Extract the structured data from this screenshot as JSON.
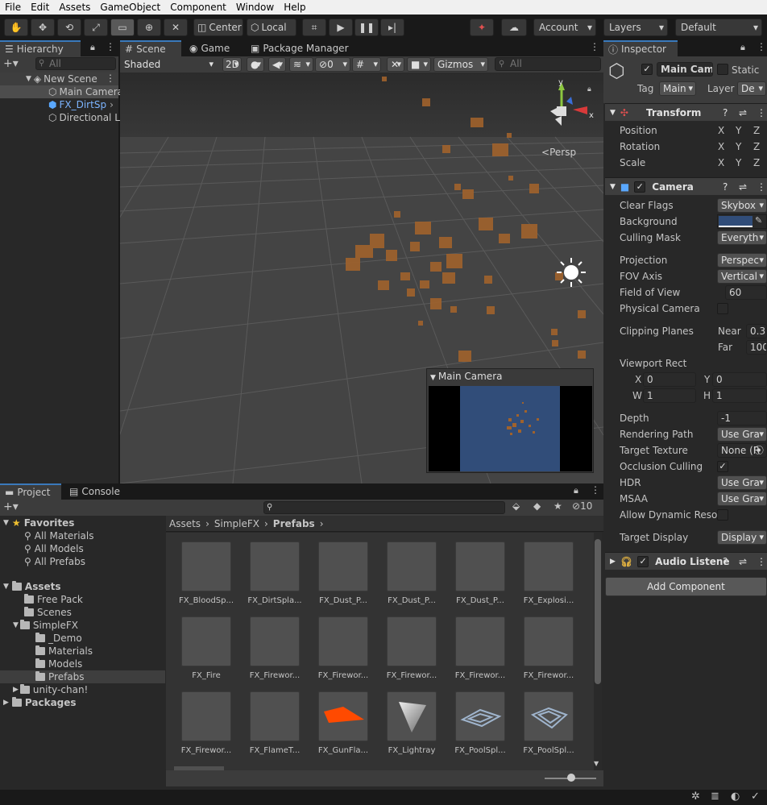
{
  "menu": [
    "File",
    "Edit",
    "Assets",
    "GameObject",
    "Component",
    "Window",
    "Help"
  ],
  "toolbar": {
    "pivot": "Center",
    "space": "Local",
    "account": "Account",
    "layers": "Layers",
    "layout": "Default"
  },
  "hierarchy": {
    "tab": "Hierarchy",
    "search_placeholder": "All",
    "scene": "New Scene",
    "items": [
      "Main Camera",
      "FX_DirtSp",
      "Directional L"
    ]
  },
  "scene": {
    "tabs": [
      "Scene",
      "Game",
      "Package Manager"
    ],
    "shading": "Shaded",
    "twod": "2D",
    "hidden_count": "0",
    "gizmos": "Gizmos",
    "search_placeholder": "All",
    "persp": "Persp",
    "preview_title": "Main Camera"
  },
  "inspector": {
    "tab": "Inspector",
    "object_name": "Main Came",
    "static": "Static",
    "tag_label": "Tag",
    "tag": "Main",
    "layer_label": "Layer",
    "layer": "De",
    "transform": {
      "title": "Transform",
      "rows": [
        "Position",
        "Rotation",
        "Scale"
      ],
      "axes": [
        "X",
        "Y",
        "Z"
      ]
    },
    "camera": {
      "title": "Camera",
      "clear_flags_label": "Clear Flags",
      "clear_flags": "Skybox",
      "background_label": "Background",
      "background_color": "#314D79",
      "culling_mask_label": "Culling Mask",
      "culling_mask": "Everyth",
      "projection_label": "Projection",
      "projection": "Perspec",
      "fov_axis_label": "FOV Axis",
      "fov_axis": "Vertical",
      "fov_label": "Field of View",
      "fov": "60",
      "physical_label": "Physical Camera",
      "clipping_label": "Clipping Planes",
      "near_label": "Near",
      "near": "0.3",
      "far_label": "Far",
      "far": "100",
      "viewport_label": "Viewport Rect",
      "vx_label": "X",
      "vx": "0",
      "vy_label": "Y",
      "vy": "0",
      "vw_label": "W",
      "vw": "1",
      "vh_label": "H",
      "vh": "1",
      "depth_label": "Depth",
      "depth": "-1",
      "rendering_path_label": "Rendering Path",
      "rendering_path": "Use Gra",
      "target_texture_label": "Target Texture",
      "target_texture": "None (R",
      "occlusion_label": "Occlusion Culling",
      "hdr_label": "HDR",
      "hdr": "Use Gra",
      "msaa_label": "MSAA",
      "msaa": "Use Gra",
      "dyn_res_label": "Allow Dynamic Resol",
      "target_display_label": "Target Display",
      "target_display": "Display"
    },
    "audio": {
      "title": "Audio Listene"
    },
    "add_component": "Add Component"
  },
  "project": {
    "tabs": [
      "Project",
      "Console"
    ],
    "hidden_count": "10",
    "favorites": {
      "title": "Favorites",
      "items": [
        "All Materials",
        "All Models",
        "All Prefabs"
      ]
    },
    "assets_title": "Assets",
    "folders": [
      "Free Pack",
      "Scenes",
      "SimpleFX",
      "_Demo",
      "Materials",
      "Models",
      "Prefabs",
      "unity-chan!"
    ],
    "packages": "Packages",
    "breadcrumb": [
      "Assets",
      "SimpleFX",
      "Prefabs"
    ],
    "items": [
      "FX_BloodSp...",
      "FX_DirtSpla...",
      "FX_Dust_P...",
      "FX_Dust_P...",
      "FX_Dust_P...",
      "FX_Explosi...",
      "FX_Fire",
      "FX_Firewor...",
      "FX_Firewor...",
      "FX_Firewor...",
      "FX_Firewor...",
      "FX_Firewor...",
      "FX_Firewor...",
      "FX_FlameT...",
      "FX_GunFla...",
      "FX_Lightray",
      "FX_PoolSpl...",
      "FX_PoolSpl..."
    ]
  }
}
